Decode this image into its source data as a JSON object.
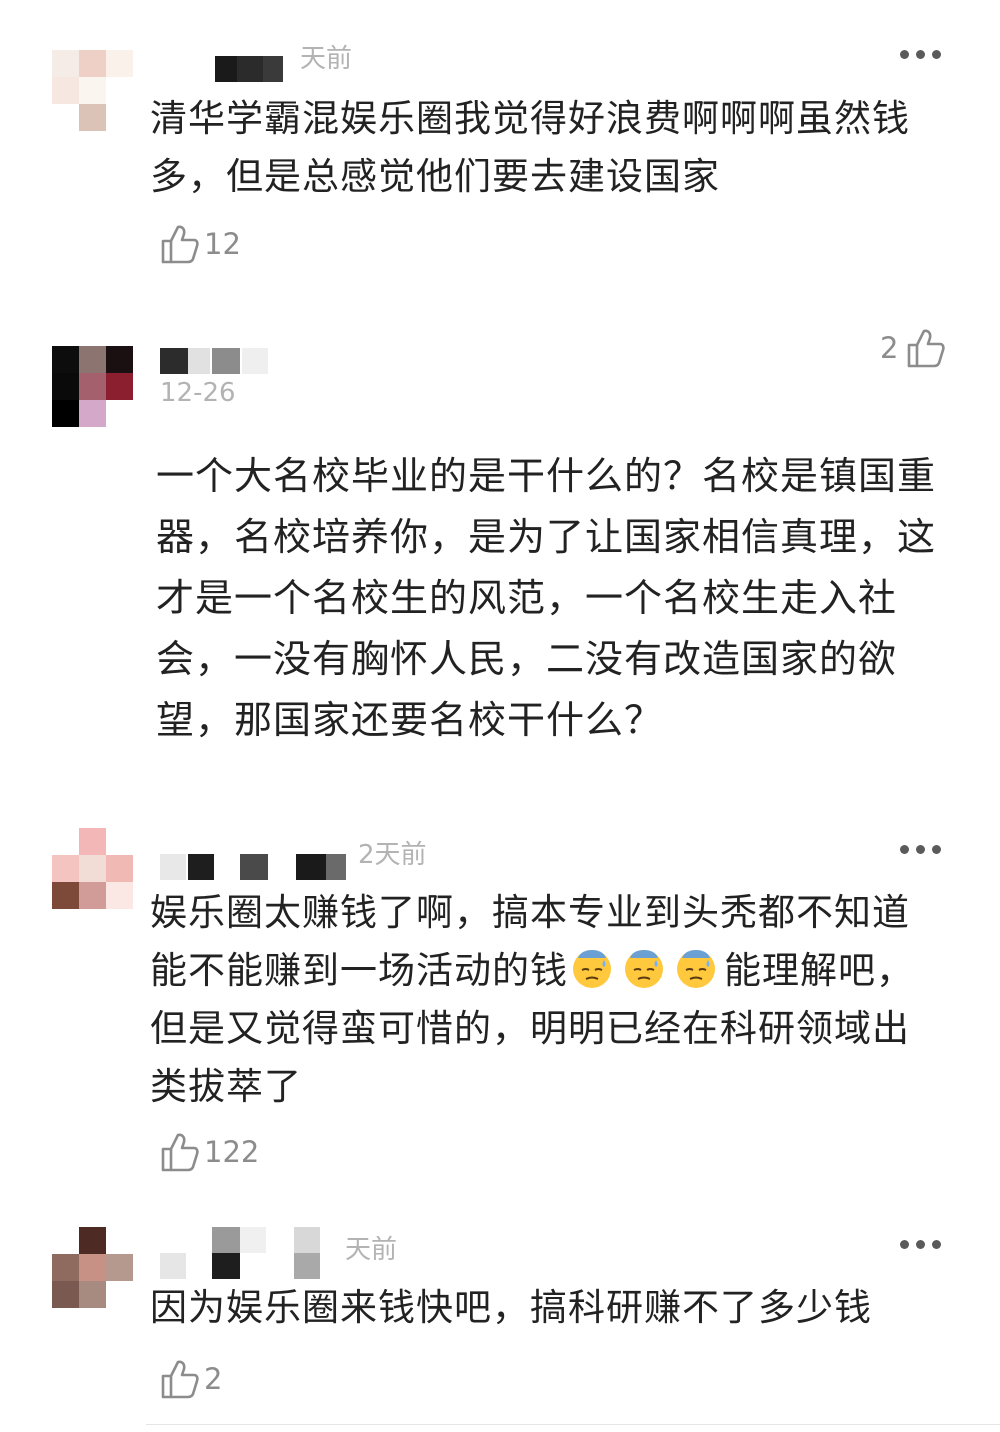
{
  "comments": [
    {
      "time": "天前",
      "text": "清华学霸混娱乐圈我觉得好浪费啊啊啊虽然钱多，但是总感觉他们要去建设国家",
      "likes": "12"
    },
    {
      "time": "12-26",
      "text": "一个大名校毕业的是干什么的？名校是镇国重器，名校培养你，是为了让国家相信真理，这才是一个名校生的风范，一个名校生走入社会，一没有胸怀人民，二没有改造国家的欲望，那国家还要名校干什么？",
      "likes": "2"
    },
    {
      "time": "2天前",
      "text_before_emoji": "娱乐圈太赚钱了啊，搞本专业到头秃都不知道能不能赚到一场活动的钱",
      "emoji": [
        "sweat-emoji",
        "sweat-emoji",
        "sweat-emoji"
      ],
      "text_after_emoji": "能理解吧，但是又觉得蛮可惜的，明明已经在科研领域出类拔萃了",
      "likes": "122"
    },
    {
      "time": "天前",
      "text": "因为娱乐圈来钱快吧，搞科研赚不了多少钱",
      "likes": "2"
    }
  ],
  "icons": {
    "like": "thumbs-up-outline-icon",
    "more": "more-dots-icon"
  },
  "colors": {
    "text": "#222222",
    "meta": "#b3b3b3",
    "like": "#8c8c8c",
    "emoji": "#ffc83d"
  }
}
